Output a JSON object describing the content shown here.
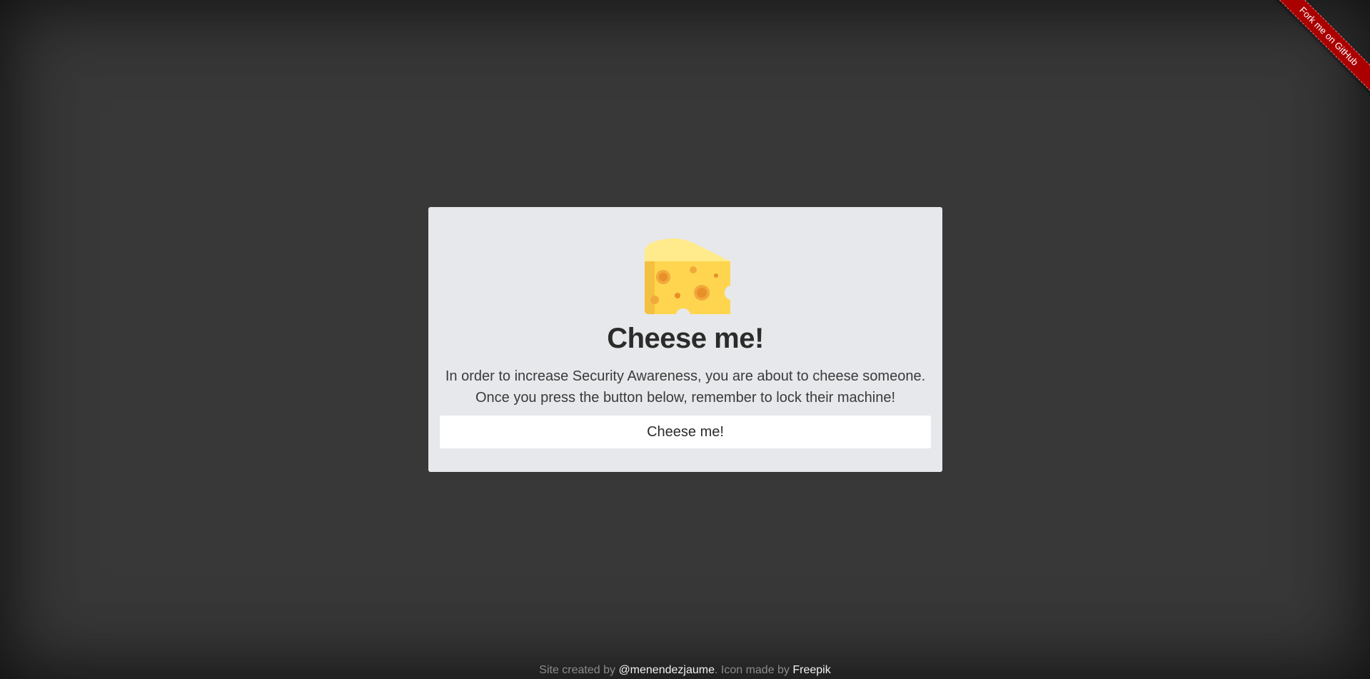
{
  "card": {
    "icon": "cheese-icon",
    "title": "Cheese me!",
    "description_line1": "In order to increase Security Awareness, you are about to cheese someone.",
    "description_line2": "Once you press the button below, remember to lock their machine!",
    "button_label": "Cheese me!"
  },
  "ribbon": {
    "label": "Fork me on GitHub",
    "color": "#aa0000"
  },
  "footer": {
    "prefix": "Site created by ",
    "author_link": "@menendezjaume",
    "middle": ". Icon made by ",
    "icon_credit_link": "Freepik"
  },
  "colors": {
    "background": "#383838",
    "card": "#e7e8eb",
    "button": "#ffffff",
    "cheese_light": "#ffe98a",
    "cheese_main": "#ffd64f",
    "cheese_hole": "#f2a93b"
  }
}
